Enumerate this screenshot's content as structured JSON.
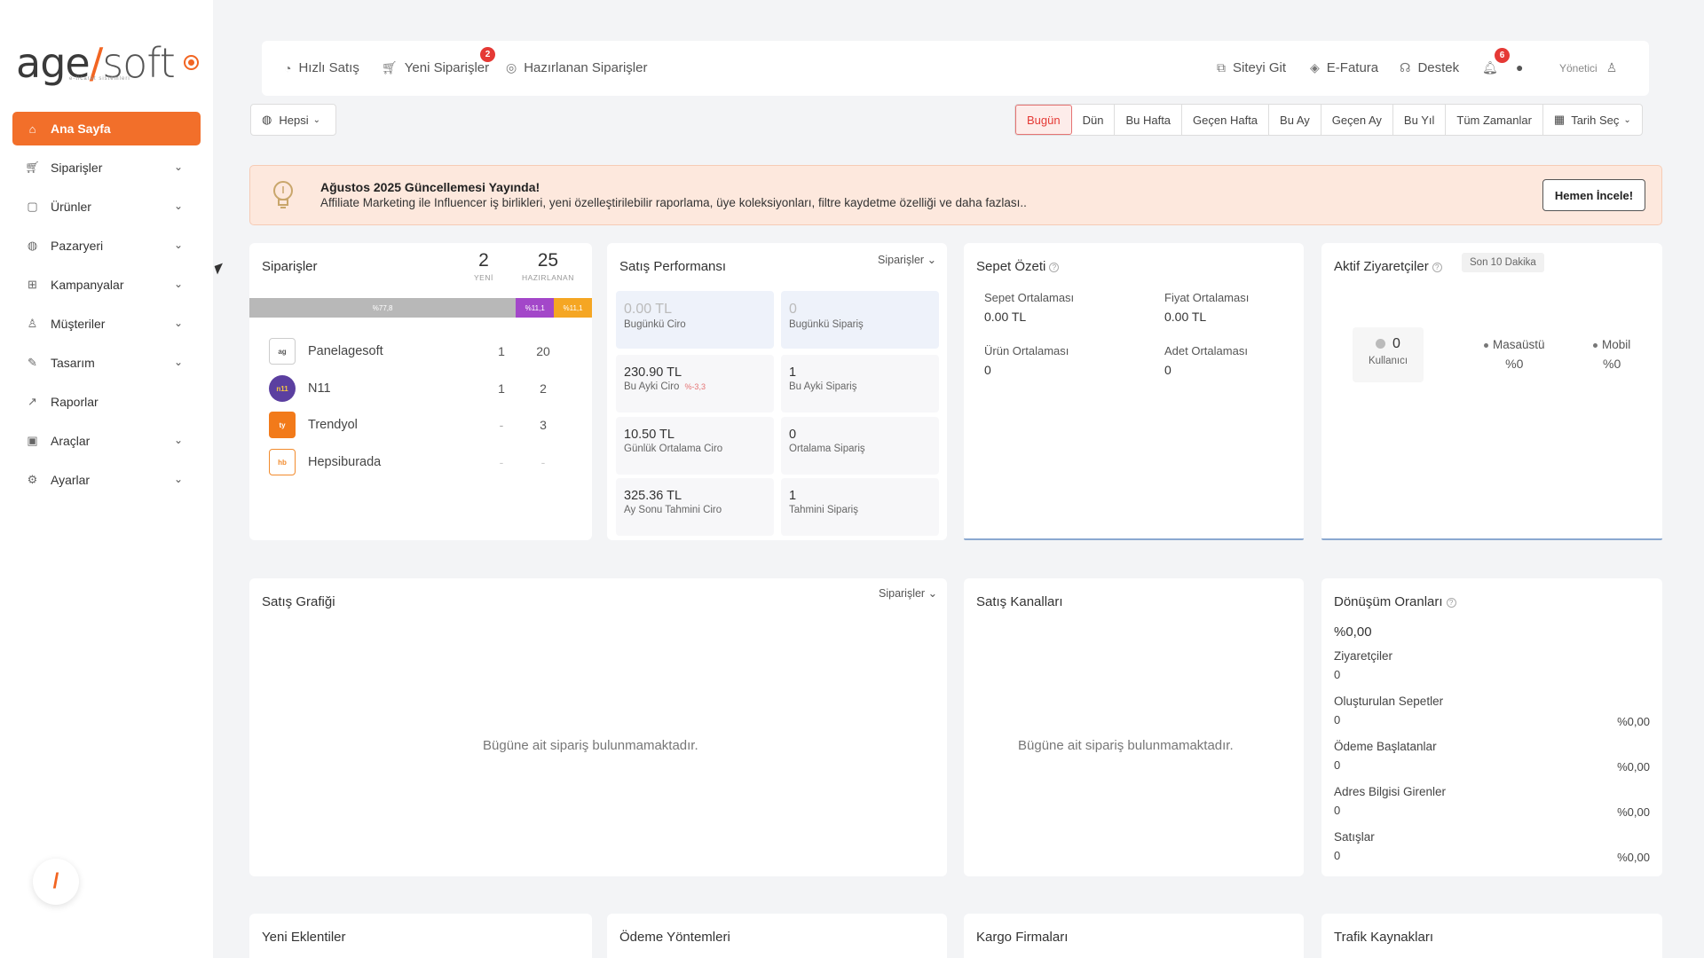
{
  "brand": {
    "logo_main": "age",
    "logo_slash": "/",
    "logo_soft": "soft",
    "logo_sub": "e-ticaret sistemleri",
    "accent": "#f26522"
  },
  "sidebar": {
    "items": [
      {
        "label": "Ana Sayfa",
        "icon": "home-icon",
        "active": true
      },
      {
        "label": "Siparişler",
        "icon": "cart-icon"
      },
      {
        "label": "Ürünler",
        "icon": "box-icon"
      },
      {
        "label": "Pazaryeri",
        "icon": "globe-icon"
      },
      {
        "label": "Kampanyalar",
        "icon": "gift-icon"
      },
      {
        "label": "Müşteriler",
        "icon": "user-icon"
      },
      {
        "label": "Tasarım",
        "icon": "design-icon"
      },
      {
        "label": "Raporlar",
        "icon": "chart-icon"
      },
      {
        "label": "Araçlar",
        "icon": "tools-icon"
      },
      {
        "label": "Ayarlar",
        "icon": "settings-icon"
      }
    ],
    "help_glyph": "/"
  },
  "topbar": {
    "quick_sale": "Hızlı Satış",
    "new_orders": "Yeni Siparişler",
    "new_orders_badge": "2",
    "prepared_orders": "Hazırlanan Siparişler",
    "go_site": "Siteyi Git",
    "e_invoice": "E-Fatura",
    "support": "Destek",
    "notif_badge": "6",
    "user": "Yönetici"
  },
  "filters": {
    "scope": "Hepsi",
    "date_tabs": [
      "Bugün",
      "Dün",
      "Bu Hafta",
      "Geçen Hafta",
      "Bu Ay",
      "Geçen Ay",
      "Bu Yıl",
      "Tüm Zamanlar"
    ],
    "active_tab": "Bugün",
    "pick_date": "Tarih Seç"
  },
  "announcement": {
    "title": "Ağustos 2025 Güncellemesi Yayında!",
    "body": "Affiliate Marketing ile Influencer iş birlikleri, yeni özelleştirilebilir raporlama, üye koleksiyonları, filtre kaydetme özelliği ve daha fazlası..",
    "button": "Hemen İncele!"
  },
  "orders_card": {
    "title": "Siparişler",
    "new_count": "2",
    "new_label": "YENİ",
    "prepared_count": "25",
    "prepared_label": "HAZIRLANAN",
    "bar": [
      {
        "label": "%77,8",
        "share": 0.778,
        "color": "#b8b8b8"
      },
      {
        "label": "%11,1",
        "share": 0.111,
        "color": "#a347c9"
      },
      {
        "label": "%11,1",
        "share": 0.111,
        "color": "#f5a623"
      }
    ],
    "markets": [
      {
        "name": "Panelagesoft",
        "new": "1",
        "prepared": "20"
      },
      {
        "name": "N11",
        "new": "1",
        "prepared": "2"
      },
      {
        "name": "Trendyol",
        "new": "-",
        "prepared": "3"
      },
      {
        "name": "Hepsiburada",
        "new": "-",
        "prepared": "-"
      }
    ]
  },
  "sales_perf": {
    "title": "Satış Performansı",
    "dropdown": "Siparişler",
    "boxes": [
      {
        "value": "0.00 TL",
        "label": "Bugünkü Ciro"
      },
      {
        "value": "0",
        "label": "Bugünkü Sipariş"
      },
      {
        "value": "230.90 TL",
        "label": "Bu Ayki Ciro",
        "change": "%-3,3"
      },
      {
        "value": "1",
        "label": "Bu Ayki Sipariş"
      },
      {
        "value": "10.50 TL",
        "label": "Günlük Ortalama Ciro"
      },
      {
        "value": "0",
        "label": "Ortalama Sipariş"
      },
      {
        "value": "325.36 TL",
        "label": "Ay Sonu Tahmini Ciro"
      },
      {
        "value": "1",
        "label": "Tahmini Sipariş"
      }
    ]
  },
  "basket": {
    "title": "Sepet Özeti",
    "items": [
      {
        "label": "Sepet Ortalaması",
        "value": "0.00 TL"
      },
      {
        "label": "Fiyat Ortalaması",
        "value": "0.00 TL"
      },
      {
        "label": "Ürün Ortalaması",
        "value": "0"
      },
      {
        "label": "Adet Ortalaması",
        "value": "0"
      }
    ]
  },
  "visitors": {
    "title": "Aktif Ziyaretçiler",
    "range": "Son 10 Dakika",
    "users_count": "0",
    "users_label": "Kullanıcı",
    "desktop_label": "Masaüstü",
    "desktop_pct": "%0",
    "mobile_label": "Mobil",
    "mobile_pct": "%0"
  },
  "sales_chart": {
    "title": "Satış Grafiği",
    "dropdown": "Siparişler",
    "empty": "Bügüne ait sipariş bulunmamaktadır."
  },
  "sales_channels": {
    "title": "Satış Kanalları",
    "empty": "Bügüne ait sipariş bulunmamaktadır."
  },
  "conversion": {
    "title": "Dönüşüm Oranları",
    "total": "%0,00",
    "rows": [
      {
        "label": "Ziyaretçiler",
        "value": "0",
        "pct": ""
      },
      {
        "label": "Oluşturulan Sepetler",
        "value": "0",
        "pct": "%0,00"
      },
      {
        "label": "Ödeme Başlatanlar",
        "value": "0",
        "pct": "%0,00"
      },
      {
        "label": "Adres Bilgisi Girenler",
        "value": "0",
        "pct": "%0,00"
      },
      {
        "label": "Satışlar",
        "value": "0",
        "pct": "%0,00"
      }
    ]
  },
  "bottom_cards": [
    "Yeni Eklentiler",
    "Ödeme Yöntemleri",
    "Kargo Firmaları",
    "Trafik Kaynakları"
  ]
}
